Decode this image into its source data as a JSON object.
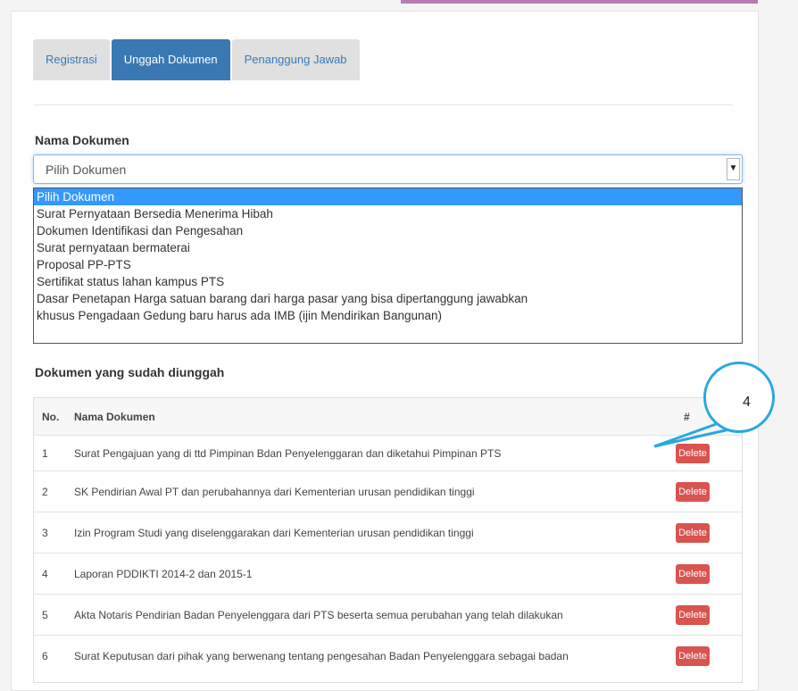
{
  "tabs": [
    {
      "label": "Registrasi",
      "active": false
    },
    {
      "label": "Unggah Dokumen",
      "active": true
    },
    {
      "label": "Penanggung Jawab",
      "active": false
    }
  ],
  "form": {
    "label": "Nama Dokumen",
    "select_value": "Pilih Dokumen",
    "options": [
      "Pilih Dokumen",
      "Surat Pernyataan Bersedia Menerima Hibah",
      "Dokumen Identifikasi dan Pengesahan",
      "Surat pernyataan bermaterai",
      "Proposal PP-PTS",
      "Sertifikat status lahan kampus PTS",
      "Dasar Penetapan Harga satuan barang dari harga pasar yang bisa dipertanggung jawabkan",
      "khusus Pengadaan Gedung baru harus ada IMB (ijin Mendirikan Bangunan)"
    ]
  },
  "uploaded": {
    "title": "Dokumen yang sudah diunggah",
    "headers": {
      "no": "No.",
      "name": "Nama Dokumen",
      "action": "#"
    },
    "delete_label": "Delete",
    "rows": [
      {
        "no": "1",
        "name": "Surat Pengajuan yang di ttd Pimpinan Bdan Penyelenggaran dan diketahui Pimpinan PTS"
      },
      {
        "no": "2",
        "name": "SK Pendirian Awal PT dan perubahannya dari Kementerian urusan pendidikan tinggi"
      },
      {
        "no": "3",
        "name": "Izin Program Studi yang diselenggarakan dari Kementerian urusan pendidikan tinggi"
      },
      {
        "no": "4",
        "name": "Laporan PDDIKTI 2014-2 dan 2015-1"
      },
      {
        "no": "5",
        "name": "Akta Notaris Pendirian Badan Penyelenggara dari PTS beserta semua perubahan yang telah dilakukan"
      },
      {
        "no": "6",
        "name": "Surat Keputusan dari pihak yang berwenang tentang pengesahan Badan Penyelenggara sebagai badan"
      }
    ]
  },
  "callout": {
    "number": "4"
  },
  "colors": {
    "accent": "#3a78b4",
    "danger": "#d9534f",
    "callout": "#29a8df",
    "top_bar": "#b77bb6"
  }
}
